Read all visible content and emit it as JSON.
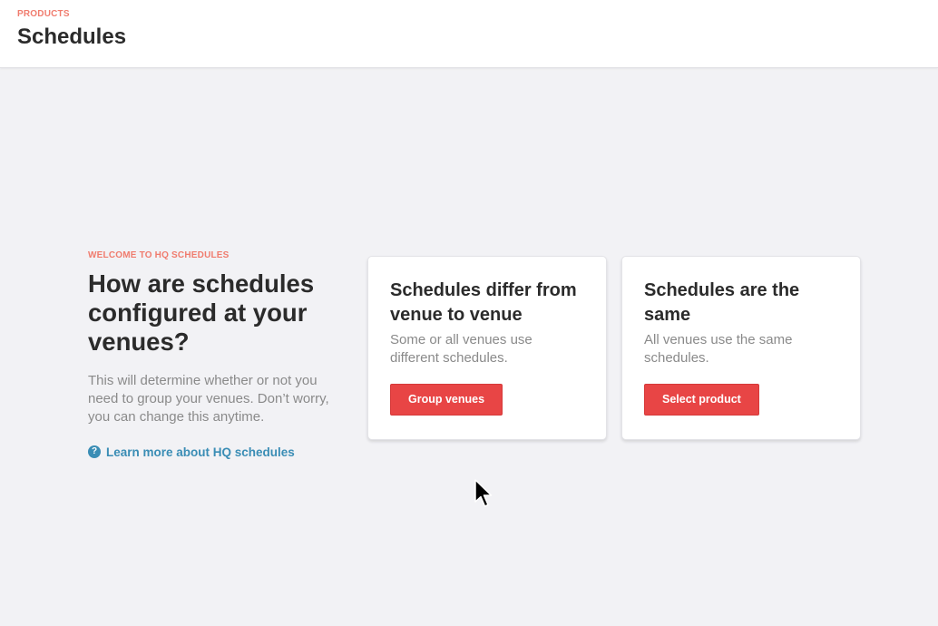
{
  "header": {
    "eyebrow": "PRODUCTS",
    "title": "Schedules"
  },
  "intro": {
    "eyebrow": "WELCOME TO HQ SCHEDULES",
    "heading": "How are schedules configured at your venues?",
    "description": "This will determine whether or not you need to group your venues. Don’t worry, you can change this anytime.",
    "learn_link": "Learn more about HQ schedules",
    "help_icon_glyph": "?"
  },
  "cards": [
    {
      "title": "Schedules differ from venue to venue",
      "description": "Some or all venues use different schedules.",
      "button_label": "Group venues"
    },
    {
      "title": "Schedules are the same",
      "description": "All venues use the same schedules.",
      "button_label": "Select product"
    }
  ],
  "icons": {
    "help": "help-circle-icon",
    "cursor": "mouse-pointer-icon"
  },
  "colors": {
    "accent": "#e84545",
    "eyebrow": "#f07c6e",
    "link": "#3a8db5",
    "background": "#f2f2f5"
  }
}
